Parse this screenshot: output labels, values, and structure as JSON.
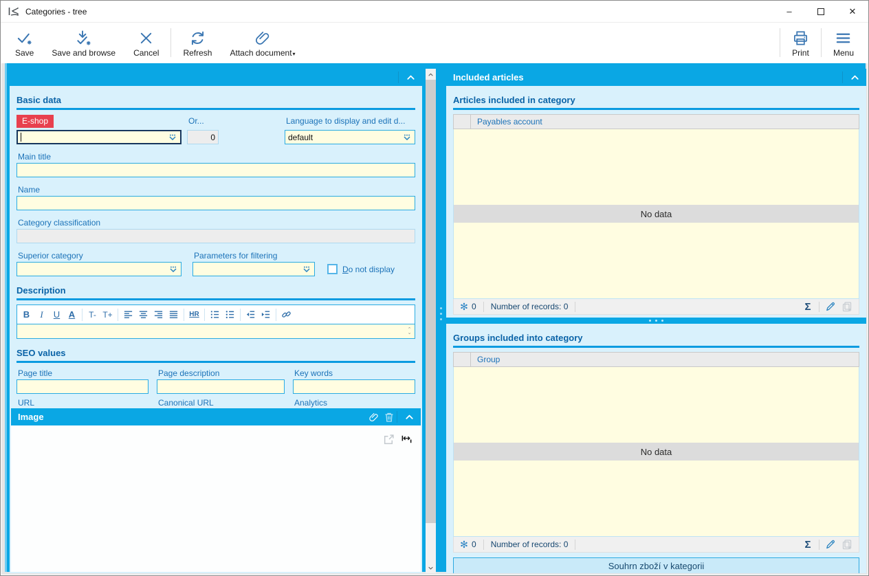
{
  "window": {
    "title": "Categories - tree"
  },
  "titlebar_controls": {
    "minimize": "–",
    "close": "✕"
  },
  "toolbar": {
    "items": [
      {
        "label": "Save",
        "icon": "save-icon"
      },
      {
        "label": "Save and browse",
        "icon": "save-and-browse-icon"
      },
      {
        "label": "Cancel",
        "icon": "cancel-x-icon"
      },
      {
        "label": "Refresh",
        "icon": "refresh-icon"
      },
      {
        "label": "Attach document",
        "icon": "attach-paperclip-icon",
        "has_dropdown": true
      }
    ],
    "right_items": [
      {
        "label": "Print",
        "icon": "print-icon"
      },
      {
        "label": "Menu",
        "icon": "menu-icon"
      }
    ]
  },
  "left_panel": {
    "basic": {
      "heading": "Basic data",
      "eshop_label": "E-shop",
      "eshop_value": "",
      "or_label": "Or...",
      "or_value": "0",
      "language_label": "Language to display and edit d...",
      "language_value": "default",
      "main_title_label": "Main title",
      "main_title_value": "",
      "name_label": "Name",
      "name_value": "",
      "classification_label": "Category classification",
      "classification_value": "",
      "superior_label": "Superior category",
      "superior_value": "",
      "filtering_label": "Parameters for filtering",
      "filtering_value": "",
      "do_not_display_label": "Do not display",
      "do_not_display_checked": false
    },
    "description": {
      "heading": "Description",
      "value": "",
      "bold_label": "B",
      "italic_label": "I",
      "underline_label": "U",
      "color_label": "A",
      "smaller_label": "T-",
      "larger_label": "T+",
      "hr_label": "HR",
      "toolbar_icons": [
        "bold",
        "italic",
        "underline",
        "font-color",
        "font-smaller",
        "font-larger",
        "align-left",
        "align-center",
        "align-right",
        "justify",
        "horizontal-rule",
        "ordered-list",
        "unordered-list",
        "outdent",
        "indent",
        "insert-link"
      ]
    },
    "seo": {
      "heading": "SEO values",
      "fields": [
        {
          "label": "Page title",
          "value": ""
        },
        {
          "label": "Page description",
          "value": ""
        },
        {
          "label": "Key words",
          "value": ""
        },
        {
          "label": "URL",
          "value": ""
        },
        {
          "label": "Canonical URL",
          "value": ""
        },
        {
          "label": "Analytics",
          "value": ""
        }
      ]
    },
    "image": {
      "heading": "Image",
      "icons": [
        "attach-paperclip-icon",
        "trash-icon",
        "collapse-chevron-icon",
        "open-external-icon",
        "resize-width-icon"
      ]
    }
  },
  "right_panel": {
    "heading": "Included articles",
    "articles": {
      "heading": "Articles included in category",
      "column": "Payables account",
      "empty_text": "No data",
      "frozen_count": "0",
      "records_text": "Number of records: 0"
    },
    "groups": {
      "heading": "Groups included into category",
      "column": "Group",
      "empty_text": "No data",
      "frozen_count": "0",
      "records_text": "Number of records: 0"
    },
    "summary_button": "Souhrn zboží v kategorii",
    "footer_icons": [
      "snowflake-icon",
      "sum-sigma-icon",
      "edit-pencil-icon",
      "copy-add-icon"
    ]
  },
  "colors": {
    "accent_cyan": "#0aa7e4",
    "panel_bg": "#d9f1fc",
    "field_yellow": "#fffde1",
    "required_red": "#e8404e",
    "heading_blue": "#0a63a7",
    "label_blue": "#1b72b8",
    "rule_blue": "#0a9be0",
    "toolbar_icon_blue": "#3a76b2"
  }
}
